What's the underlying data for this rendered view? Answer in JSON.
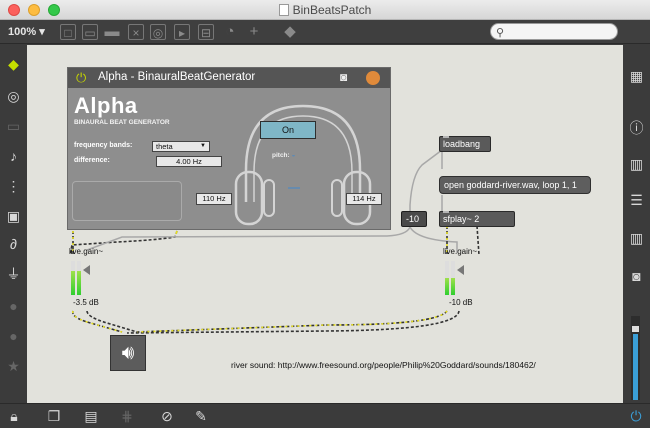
{
  "window": {
    "title": "BinBeatsPatch"
  },
  "toolbar": {
    "zoom": "100%"
  },
  "bpatcher": {
    "title": "Alpha - BinauralBeatGenerator",
    "big_title": "Alpha",
    "subtitle": "BINAURAL BEAT GENERATOR",
    "frequency_bands_label": "frequency bands:",
    "frequency_bands_value": "theta",
    "difference_label": "difference:",
    "difference_value": "4.00 Hz",
    "on_button": "On",
    "pitch_label": "pitch:",
    "left_hz": "110 Hz",
    "right_hz": "114 Hz"
  },
  "objects": {
    "loadbang": "loadbang",
    "open_message": "open goddard-river.wav, loop 1, 1",
    "sfplay": "sfplay~ 2",
    "number": "-10"
  },
  "gains": [
    {
      "label": "live.gain~",
      "db": "-3.5 dB",
      "level": 0.7
    },
    {
      "label": "live.gain~",
      "db": "-10 dB",
      "level": 0.5
    }
  ],
  "comment": "river sound: http://www.freesound.org/people/Philip%20Goddard/sounds/180462/",
  "colors": {
    "canvas": "#e2e2dc",
    "accent_on": "#7fb6c6",
    "meter": "#2fcf2f"
  }
}
